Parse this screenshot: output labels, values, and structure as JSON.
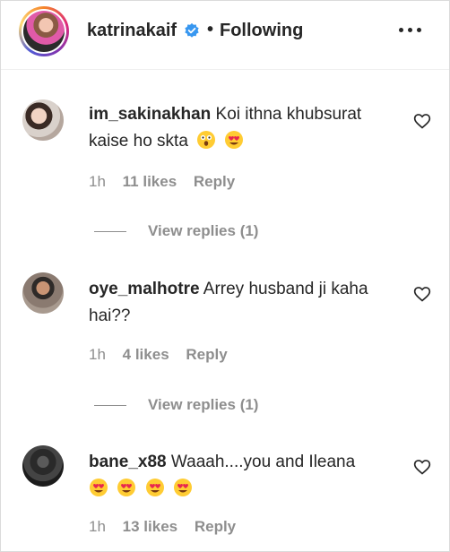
{
  "header": {
    "username": "katrinakaif",
    "separator": "•",
    "follow_status": "Following"
  },
  "comments": [
    {
      "username": "im_sakinakhan",
      "text": "Koi ithna khubsurat kaise ho skta",
      "emojis": [
        "astonished-face",
        "heart-eyes-face"
      ],
      "time": "1h",
      "likes": "11 likes",
      "reply": "Reply",
      "view_replies": "View replies (1)"
    },
    {
      "username": "oye_malhotre",
      "text": "Arrey husband ji kaha hai??",
      "emojis": [],
      "time": "1h",
      "likes": "4 likes",
      "reply": "Reply",
      "view_replies": "View replies (1)"
    },
    {
      "username": "bane_x88",
      "text": "Waaah....you and Ileana",
      "emojis": [
        "heart-eyes-face",
        "heart-eyes-face",
        "heart-eyes-face",
        "heart-eyes-face"
      ],
      "time": "1h",
      "likes": "13 likes",
      "reply": "Reply"
    }
  ],
  "colors": {
    "text": "#262626",
    "muted": "#8e8e8e",
    "verified": "#3897f0",
    "border": "#dbdbdb"
  }
}
